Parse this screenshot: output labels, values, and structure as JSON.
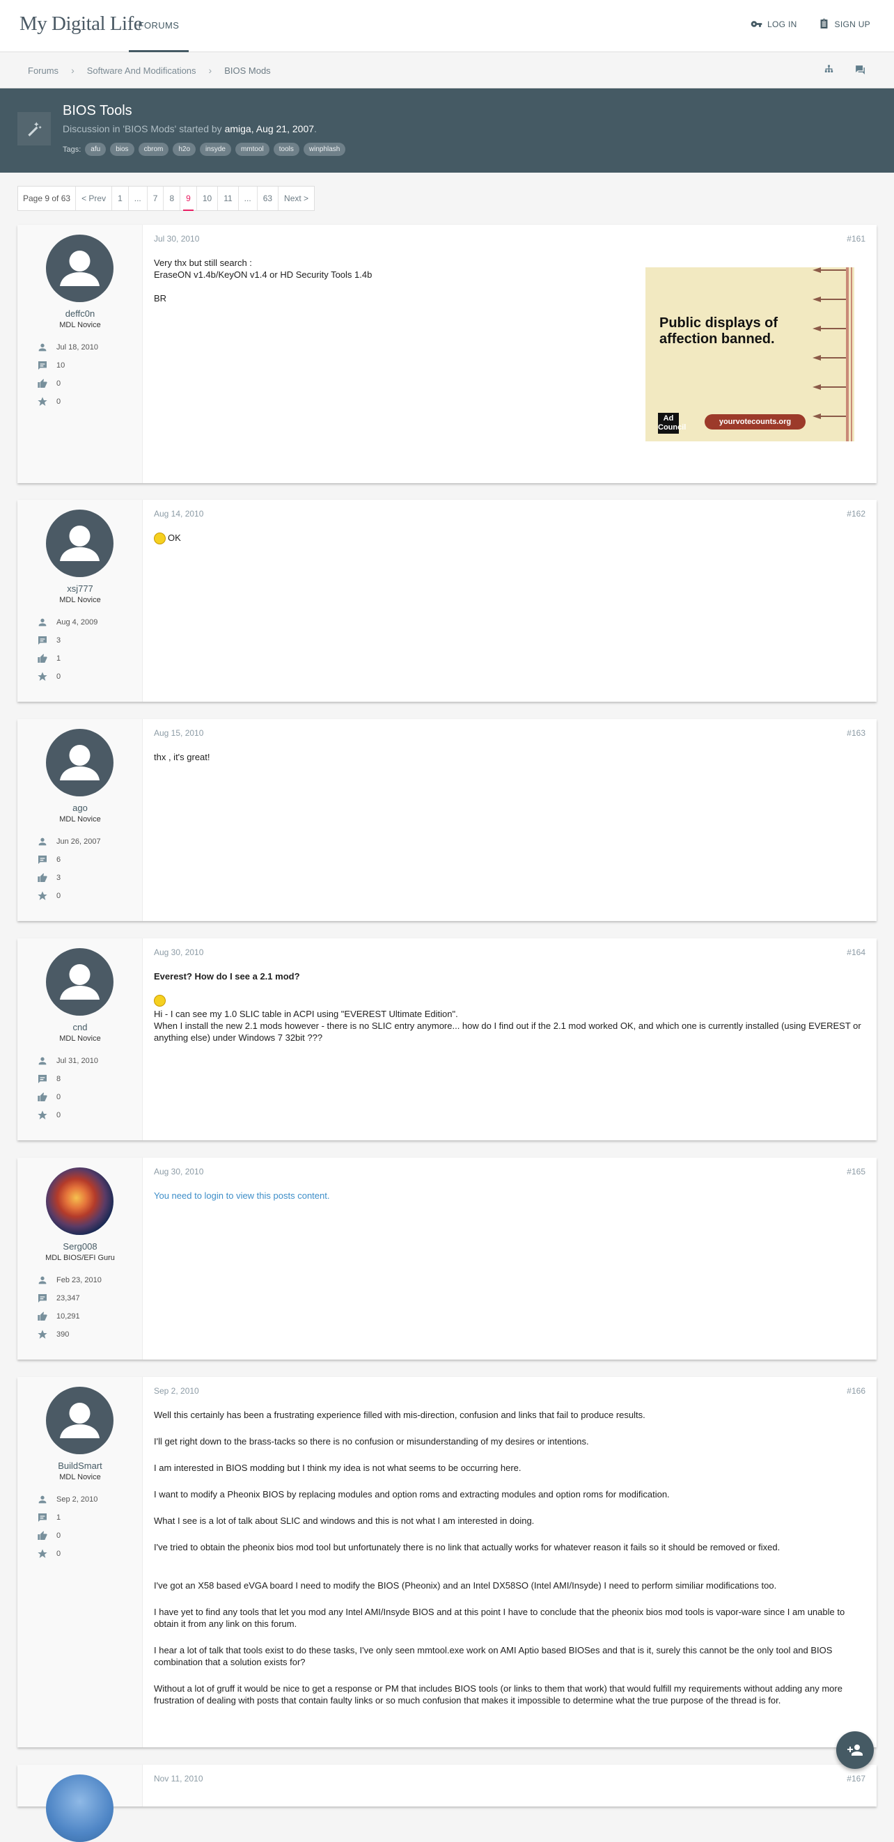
{
  "header": {
    "logo": "My Digital Life",
    "nav_forums": "FORUMS",
    "login": "LOG IN",
    "signup": "SIGN UP"
  },
  "breadcrumb": {
    "items": [
      "Forums",
      "Software And Modifications",
      "BIOS Mods"
    ]
  },
  "thread": {
    "title": "BIOS Tools",
    "meta_prefix": "Discussion in '",
    "forum": "BIOS Mods",
    "meta_mid": "' started by ",
    "author": "amiga",
    "meta_date": ", Aug 21, 2007",
    "meta_end": ".",
    "tags_label": "Tags:",
    "tags": [
      "afu",
      "bios",
      "cbrom",
      "h2o",
      "insyde",
      "mmtool",
      "tools",
      "winphlash"
    ]
  },
  "pager": {
    "label": "Page 9 of 63",
    "prev": "< Prev",
    "pages": [
      "1",
      "...",
      "7",
      "8",
      "9",
      "10",
      "11",
      "...",
      "63"
    ],
    "next": "Next >"
  },
  "posts": [
    {
      "user": "deffc0n",
      "title": "MDL Novice",
      "joined": "Jul 18, 2010",
      "messages": "10",
      "likes": "0",
      "points": "0",
      "date": "Jul 30, 2010",
      "num": "#161",
      "lines": [
        "Very thx but still search :",
        "EraseON v1.4b/KeyON v1.4 or HD Security Tools 1.4b",
        "",
        "BR"
      ],
      "ad": {
        "text": "Public displays of affection banned.",
        "logo": "Ad Council",
        "url": "yourvotecounts.org"
      }
    },
    {
      "user": "xsj777",
      "title": "MDL Novice",
      "joined": "Aug 4, 2009",
      "messages": "3",
      "likes": "1",
      "points": "0",
      "date": "Aug 14, 2010",
      "num": "#162",
      "lines": [
        "OK"
      ]
    },
    {
      "user": "ago",
      "title": "MDL Novice",
      "joined": "Jun 26, 2007",
      "messages": "6",
      "likes": "3",
      "points": "0",
      "date": "Aug 15, 2010",
      "num": "#163",
      "lines": [
        "thx , it's great!"
      ]
    },
    {
      "user": "cnd",
      "title": "MDL Novice",
      "joined": "Jul 31, 2010",
      "messages": "8",
      "likes": "0",
      "points": "0",
      "date": "Aug 30, 2010",
      "num": "#164",
      "heading": "Everest? How do I see a 2.1 mod?",
      "lines": [
        "Hi - I can see my 1.0 SLIC table in ACPI using \"EVEREST Ultimate Edition\".",
        "When I install the new 2.1 mods however - there is no SLIC entry anymore... how do I find out if the 2.1 mod worked OK, and which one is currently installed (using EVEREST or anything else) under Windows 7 32bit ???"
      ]
    },
    {
      "user": "Serg008",
      "title": "MDL BIOS/EFI Guru",
      "joined": "Feb 23, 2010",
      "messages": "23,347",
      "likes": "10,291",
      "points": "390",
      "date": "Aug 30, 2010",
      "num": "#165",
      "login_text": "You need to login to view this posts content."
    },
    {
      "user": "BuildSmart",
      "title": "MDL Novice",
      "joined": "Sep 2, 2010",
      "messages": "1",
      "likes": "0",
      "points": "0",
      "date": "Sep 2, 2010",
      "num": "#166",
      "paras": [
        "Well this certainly has been a frustrating experience filled with mis-direction, confusion and links that fail to produce results.",
        "I'll get right down to the brass-tacks so there is no confusion or misunderstanding of my desires or intentions.",
        "I am interested in BIOS modding but I think my idea is not what seems to be occurring here.",
        "I want to modify a Pheonix BIOS by replacing modules and option roms and extracting modules and option roms for modification.",
        "What I see is a lot of talk about SLIC and windows and this is not what I am interested in doing.",
        "I've tried to obtain the pheonix bios mod tool but unfortunately there is no link that actually works for whatever reason it fails so it should be removed or fixed.",
        "I've got an X58 based eVGA board I need to modify the BIOS (Pheonix) and an Intel DX58SO (Intel AMI/Insyde) I need to perform similiar modifications too.",
        "I have yet to find any tools that let you mod any Intel AMI/Insyde BIOS and at this point I have to conclude that the pheonix bios mod tools is vapor-ware since I am unable to obtain it from any link on this forum.",
        "I hear a lot of talk that tools exist to do these tasks, I've only seen mmtool.exe work on AMI Aptio based BIOSes and that is it, surely this cannot be the only tool and BIOS combination that a solution exists for?",
        "Without a lot of gruff it would be nice to get a response or PM that includes BIOS tools (or links to them that work) that would fulfill my requirements without adding any more frustration of dealing with posts that contain faulty links or so much confusion that makes it impossible to determine what the true purpose of the thread is for."
      ]
    },
    {
      "date": "Nov 11, 2010",
      "num": "#167"
    }
  ]
}
